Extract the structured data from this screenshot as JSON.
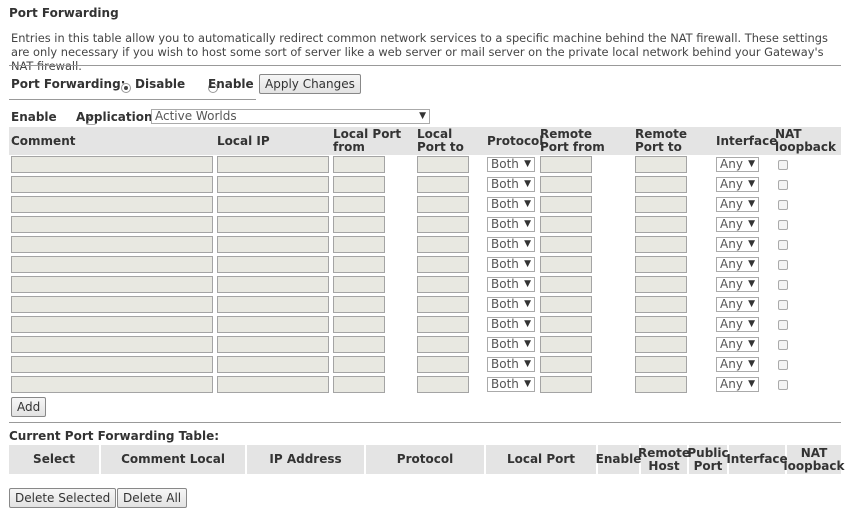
{
  "page": {
    "title": "Port Forwarding",
    "description": "Entries in this table allow you to automatically redirect common network services to a specific machine behind the NAT firewall. These settings are only necessary if you wish to host some sort of server like a web server or mail server on the private local network behind your Gateway's NAT firewall."
  },
  "mode": {
    "label": "Port Forwarding:",
    "disable_label": "Disable",
    "enable_label": "Enable",
    "selected": "Disable",
    "apply_label": "Apply Changes"
  },
  "application": {
    "enable_label": "Enable",
    "enable_checked": true,
    "label": "Application:",
    "selected": "Active Worlds"
  },
  "entry_table": {
    "headers": {
      "comment": "Comment",
      "local_ip": "Local IP",
      "local_port_from": "Local Port from",
      "local_port_to": "Local Port to",
      "protocol": "Protocol",
      "remote_port_from": "Remote Port from",
      "remote_port_to": "Remote Port to",
      "interface": "Interface",
      "nat_loopback": "NAT loopback"
    },
    "row_count": 12,
    "default_protocol": "Both",
    "default_interface": "Any",
    "add_label": "Add"
  },
  "current_table": {
    "title": "Current Port Forwarding Table:",
    "headers": [
      "Select",
      "Comment Local",
      "IP Address",
      "Protocol",
      "Local Port",
      "Enable",
      "Remote Host",
      "Public Port",
      "Interface",
      "NAT loopback"
    ]
  },
  "actions": {
    "delete_selected": "Delete Selected",
    "delete_all": "Delete All"
  },
  "icons": {
    "dropdown": "chevron-down-icon",
    "check": "checkmark-icon"
  }
}
